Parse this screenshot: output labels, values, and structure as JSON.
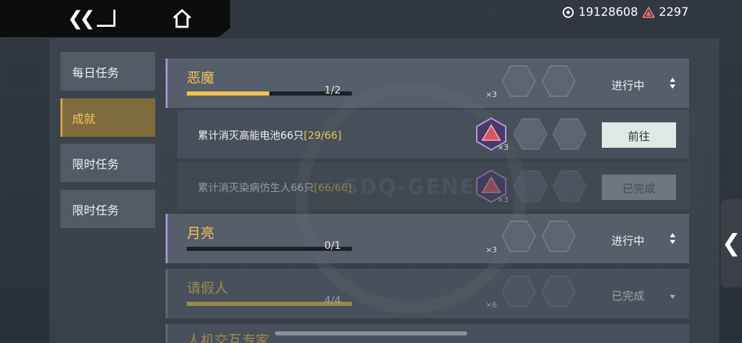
{
  "header": {
    "back_icon": "double-chevron-left-icon",
    "home_icon": "home-icon",
    "currency1": {
      "icon": "coin-icon",
      "value": "19128608"
    },
    "currency2": {
      "icon": "triangle-gem-icon",
      "value": "2297"
    }
  },
  "tabs": [
    {
      "label": "每日任务",
      "active": false
    },
    {
      "label": "成就",
      "active": true
    },
    {
      "label": "限时任务",
      "active": false
    },
    {
      "label": "限时任务",
      "active": false
    }
  ],
  "groups": [
    {
      "title": "恶魔",
      "count": "1/2",
      "progress": 0.5,
      "mult": "×3",
      "status": "进行中"
    },
    {
      "title": "月亮",
      "count": "0/1",
      "progress": 0.0,
      "mult": "×3",
      "status": "进行中"
    },
    {
      "title": "请假人",
      "count": "4/4",
      "progress": 1.0,
      "mult": "×6",
      "status": "已完成"
    },
    {
      "title": "人机交互专家"
    }
  ],
  "subtasks": [
    {
      "text": "累计消灭高能电池66只",
      "progress": "[29/66]",
      "mult": "×3",
      "button": "前往"
    },
    {
      "text": "累计消灭染病仿生人66只",
      "progress": "[66/66]",
      "mult": "×3",
      "button": "已完成"
    }
  ],
  "watermark": "SDQ-GENE",
  "side_handle_icon": "chevron-left-icon",
  "colors": {
    "accent": "#f2c14e",
    "purple": "#a78fd0",
    "active_tab": "#7f6b3e"
  }
}
